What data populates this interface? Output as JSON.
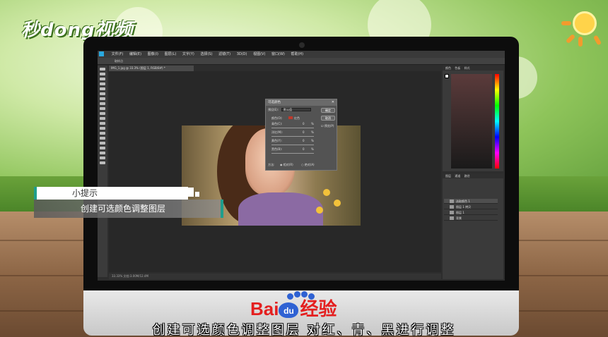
{
  "brand": {
    "logo_text": "秒dong视频"
  },
  "ps": {
    "menu": [
      "文件(F)",
      "编辑(E)",
      "图像(I)",
      "图层(L)",
      "文字(Y)",
      "选择(S)",
      "滤镜(T)",
      "3D(D)",
      "视图(V)",
      "窗口(W)",
      "帮助(H)"
    ],
    "options_label": "取样点",
    "doc_tab": "IMG_1.jpg @ 33.3% (图层 1, RGB/8#) *",
    "status": "33.33%   文档:3.00M/12.4M",
    "dialog": {
      "title": "可选颜色",
      "preset_label": "预设(E):",
      "preset_value": "默认值",
      "colors_label": "颜色(O):",
      "colors_value": "红色",
      "sliders": [
        {
          "label": "青色(C):",
          "value": "0",
          "unit": "%"
        },
        {
          "label": "洋红(M):",
          "value": "0",
          "unit": "%"
        },
        {
          "label": "黄色(Y):",
          "value": "0",
          "unit": "%"
        },
        {
          "label": "黑色(B):",
          "value": "0",
          "unit": "%"
        }
      ],
      "method_label": "方法:",
      "method_relative": "相对(R)",
      "method_absolute": "绝对(A)",
      "ok": "确定",
      "cancel": "取消",
      "preview": "预览(P)",
      "swatch_color": "#c0392b"
    },
    "panels": {
      "color_tabs": [
        "颜色",
        "色板",
        "样式"
      ],
      "layer_tabs": [
        "图层",
        "通道",
        "路径"
      ],
      "layers": [
        "选取颜色 1",
        "图层 1 拷贝",
        "图层 1",
        "背景"
      ]
    }
  },
  "tip": {
    "heading": "小提示",
    "body": "创建可选颜色调整图层"
  },
  "baidu": {
    "bai": "Bai",
    "du": "du",
    "jingyan": "经验"
  },
  "subtitle": "创建可选颜色调整图层 对红、青、黑进行调整",
  "colors": {
    "accent": "#1e9e8c",
    "ps_blue": "#2aa9e0",
    "baidu_red": "#e41f1f",
    "baidu_blue": "#2f62d3"
  }
}
